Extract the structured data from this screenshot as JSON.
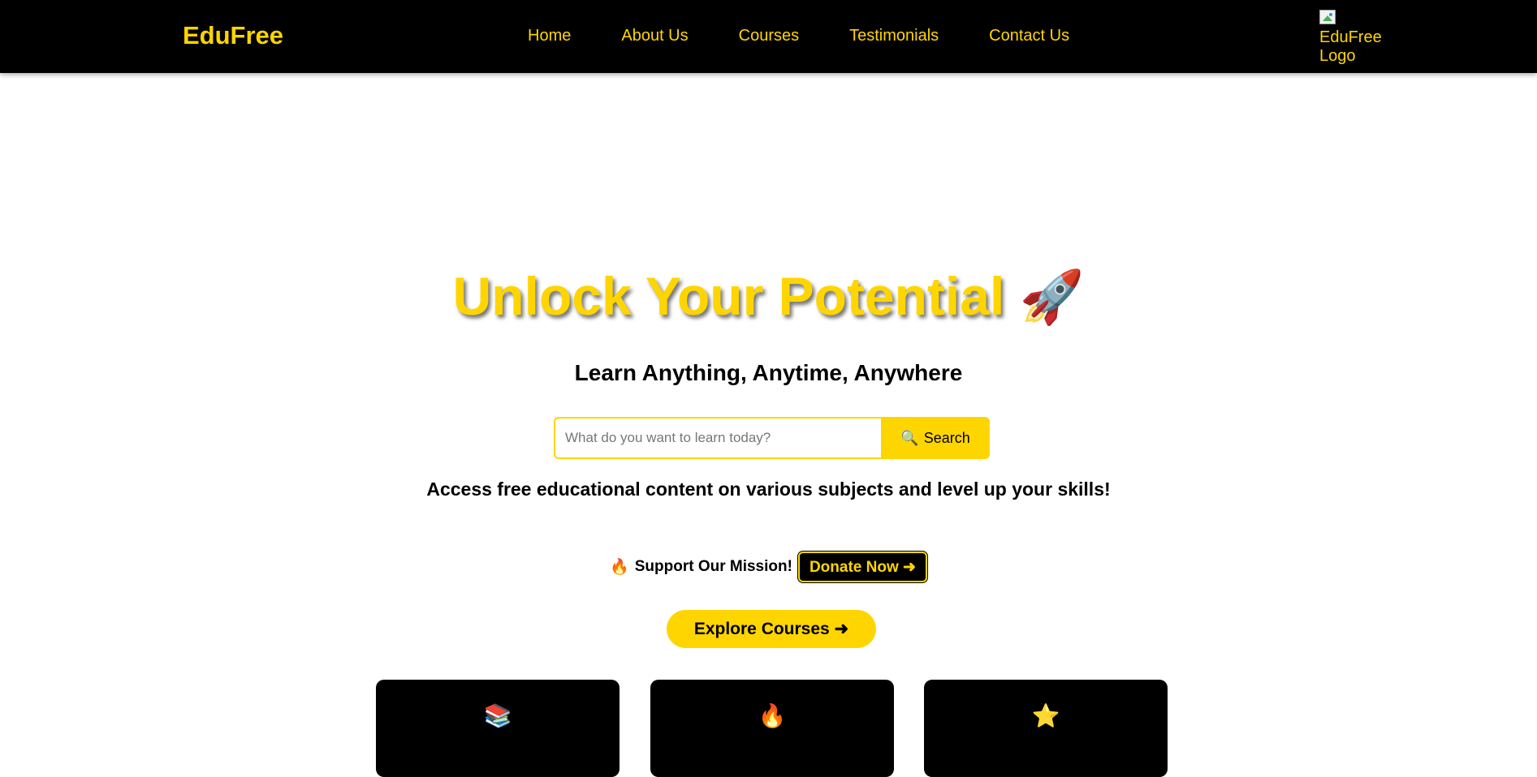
{
  "header": {
    "brand": "EduFree",
    "nav": [
      {
        "label": "Home"
      },
      {
        "label": "About Us"
      },
      {
        "label": "Courses"
      },
      {
        "label": "Testimonials"
      },
      {
        "label": "Contact Us"
      }
    ],
    "logo_alt": "EduFree Logo"
  },
  "hero": {
    "title": "Unlock Your Potential",
    "title_emoji": "🚀",
    "subtitle": "Learn Anything, Anytime, Anywhere",
    "search": {
      "placeholder": "What do you want to learn today?",
      "value": "",
      "button_icon": "🔍",
      "button_label": "Search"
    },
    "description": "Access free educational content on various subjects and level up your skills!",
    "support": {
      "icon": "🔥",
      "text": "Support Our Mission!",
      "donate_label": "Donate Now ➜"
    },
    "explore_label": "Explore Courses ➜"
  },
  "feature_cards": [
    {
      "icon": "📚"
    },
    {
      "icon": "🔥"
    },
    {
      "icon": "⭐"
    }
  ],
  "colors": {
    "accent": "#ffd500",
    "header_bg": "#000000",
    "page_bg": "#ffffff"
  }
}
